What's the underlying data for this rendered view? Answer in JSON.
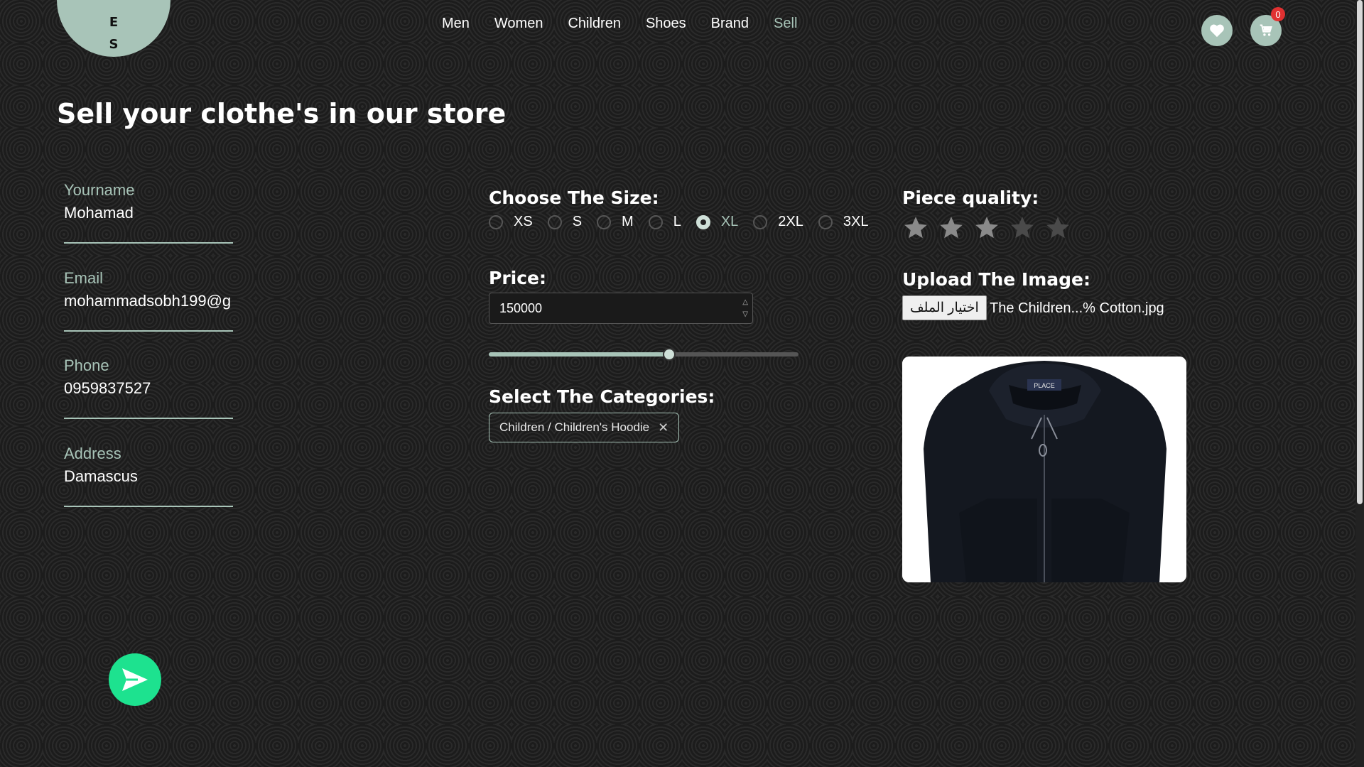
{
  "logo": {
    "line1": "E",
    "line2": "S"
  },
  "nav": [
    {
      "label": "Men"
    },
    {
      "label": "Women"
    },
    {
      "label": "Children"
    },
    {
      "label": "Shoes"
    },
    {
      "label": "Brand"
    },
    {
      "label": "Sell",
      "active": true
    }
  ],
  "header": {
    "wishlist_icon": "heart-icon",
    "cart_icon": "cart-icon",
    "cart_count": "0"
  },
  "page_title": "Sell your clothe's in our store",
  "form": {
    "name_label": "Yourname",
    "name_value": "Mohamad",
    "email_label": "Email",
    "email_value": "mohammadsobh199@g",
    "phone_label": "Phone",
    "phone_value": "0959837527",
    "address_label": "Address",
    "address_value": "Damascus"
  },
  "size": {
    "label": "Choose The Size:",
    "options": [
      "XS",
      "S",
      "M",
      "L",
      "XL",
      "2XL",
      "3XL"
    ],
    "selected": "XL"
  },
  "price": {
    "label": "Price:",
    "value": "150000",
    "slider_fraction": 0.58
  },
  "categories": {
    "label": "Select The Categories:",
    "selected": "Children / Children's Hoodie"
  },
  "quality": {
    "label": "Piece quality:",
    "rating": 3,
    "max": 5
  },
  "upload": {
    "label": "Upload The Image:",
    "button_label": "اختيار الملف",
    "file_name": "The Children...% Cotton.jpg",
    "preview_brand": "PLACE"
  },
  "colors": {
    "accent": "#a8c4b8",
    "send": "#1de28f",
    "badge": "#e03131"
  }
}
